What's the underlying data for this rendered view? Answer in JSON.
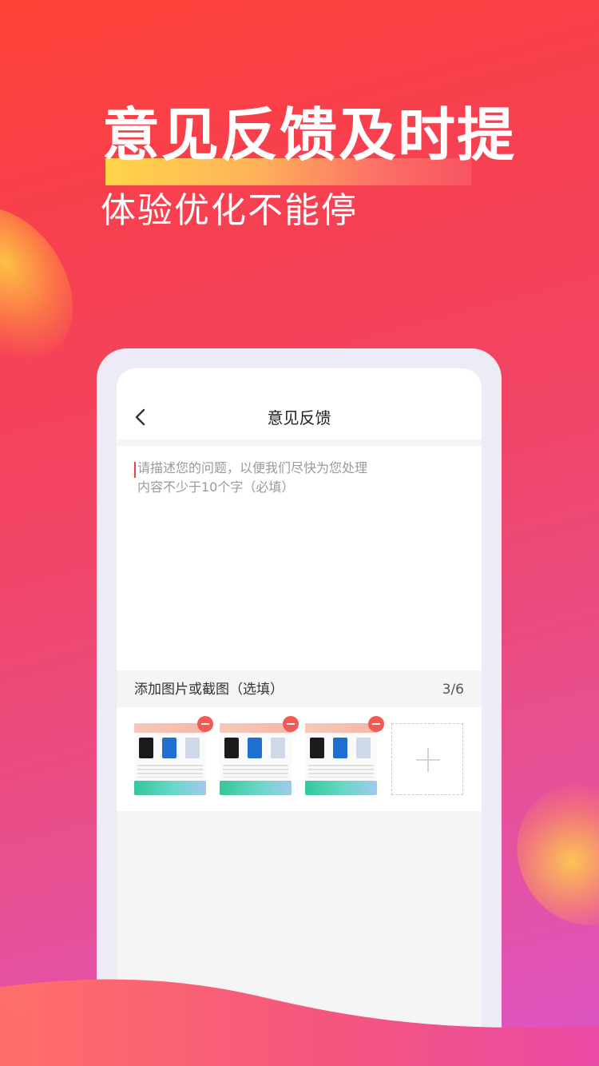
{
  "headline": "意见反馈及时提",
  "subheadline": "体验优化不能停",
  "screen": {
    "title": "意见反馈",
    "textarea": {
      "placeholder_line1": "请描述您的问题，以便我们尽快为您处理",
      "placeholder_line2": "内容不少于10个字（必填）"
    },
    "images": {
      "label": "添加图片或截图（选填）",
      "count": "3/6",
      "thumbnails": 3
    }
  },
  "colors": {
    "accent": "#f05c55",
    "background_top": "#ff4337",
    "background_bottom": "#dd55c6"
  }
}
